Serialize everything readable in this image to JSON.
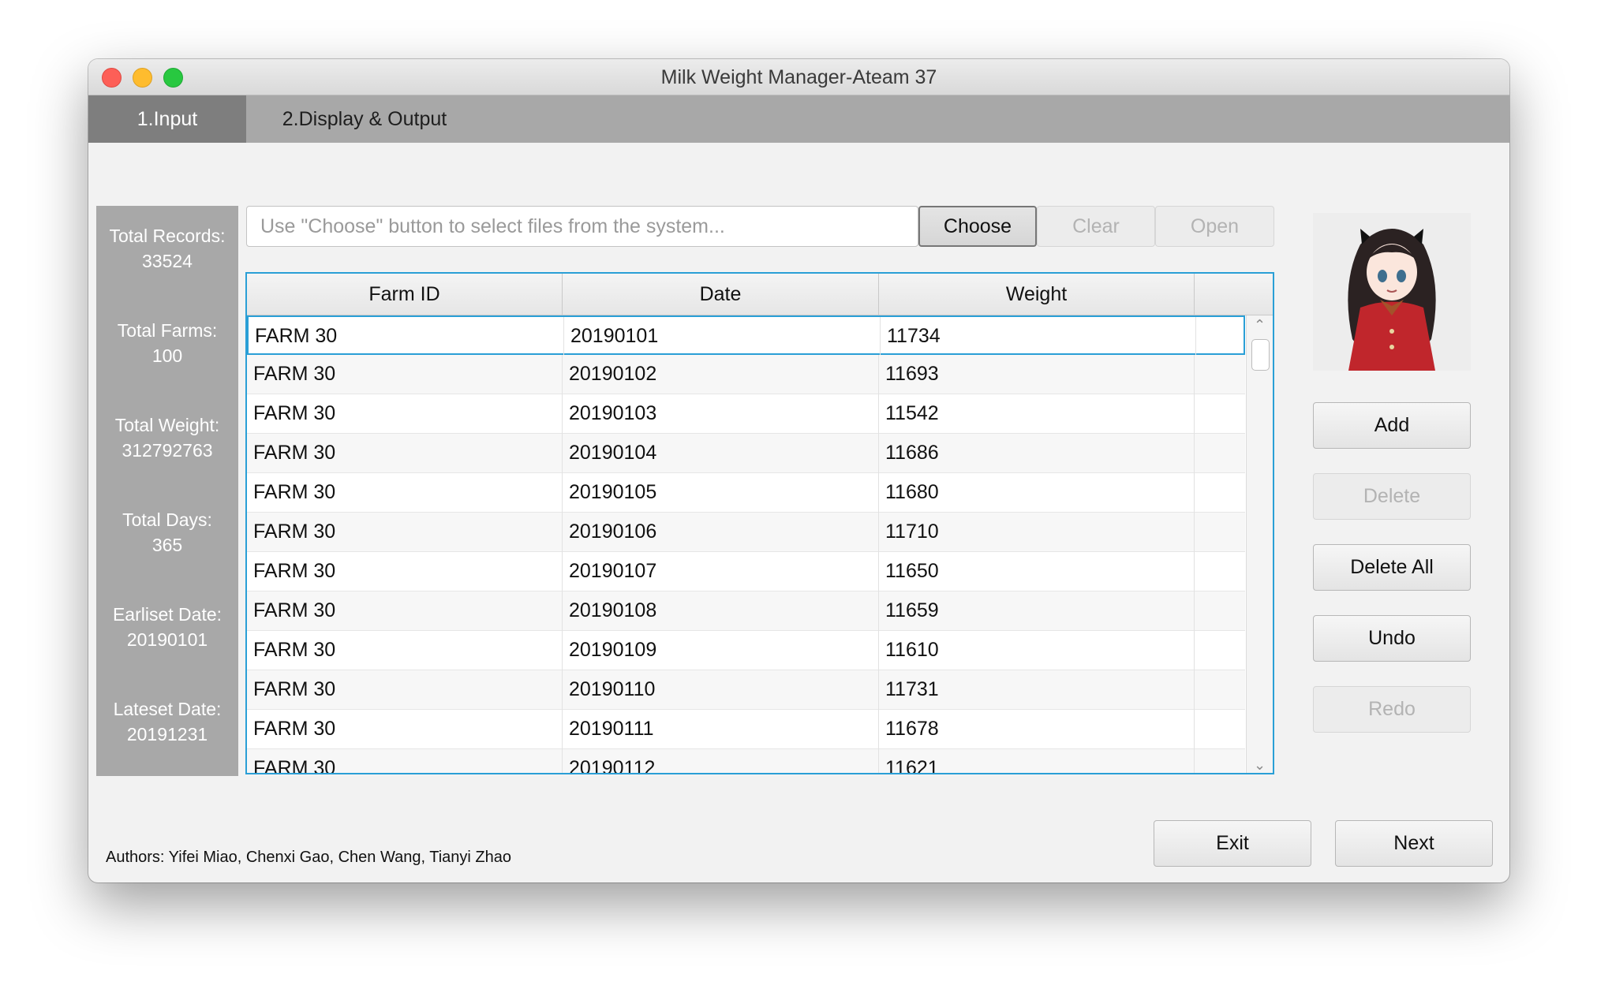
{
  "window": {
    "title": "Milk Weight Manager-Ateam 37"
  },
  "tabs": [
    {
      "label": "1.Input",
      "active": true
    },
    {
      "label": "2.Display & Output",
      "active": false
    }
  ],
  "stats": [
    {
      "label": "Total Records:",
      "value": "33524"
    },
    {
      "label": "Total Farms:",
      "value": "100"
    },
    {
      "label": "Total Weight:",
      "value": "312792763"
    },
    {
      "label": "Total Days:",
      "value": "365"
    },
    {
      "label": "Earliset Date:",
      "value": "20190101"
    },
    {
      "label": "Lateset Date:",
      "value": "20191231"
    }
  ],
  "file_input": {
    "placeholder": "Use \"Choose\" button to select files from the system..."
  },
  "file_buttons": {
    "choose": "Choose",
    "clear": "Clear",
    "open": "Open"
  },
  "table": {
    "columns": [
      "Farm ID",
      "Date",
      "Weight"
    ],
    "rows": [
      [
        "FARM 30",
        "20190101",
        "11734"
      ],
      [
        "FARM 30",
        "20190102",
        "11693"
      ],
      [
        "FARM 30",
        "20190103",
        "11542"
      ],
      [
        "FARM 30",
        "20190104",
        "11686"
      ],
      [
        "FARM 30",
        "20190105",
        "11680"
      ],
      [
        "FARM 30",
        "20190106",
        "11710"
      ],
      [
        "FARM 30",
        "20190107",
        "11650"
      ],
      [
        "FARM 30",
        "20190108",
        "11659"
      ],
      [
        "FARM 30",
        "20190109",
        "11610"
      ],
      [
        "FARM 30",
        "20190110",
        "11731"
      ],
      [
        "FARM 30",
        "20190111",
        "11678"
      ],
      [
        "FARM 30",
        "20190112",
        "11621"
      ]
    ]
  },
  "side_buttons": {
    "add": "Add",
    "delete": "Delete",
    "delete_all": "Delete All",
    "undo": "Undo",
    "redo": "Redo"
  },
  "footer": {
    "authors": "Authors: Yifei Miao, Chenxi Gao, Chen Wang, Tianyi Zhao",
    "exit": "Exit",
    "next": "Next"
  },
  "colors": {
    "accent": "#2a9fd6",
    "panel": "#a8a8a8",
    "active_tab": "#7e7e7e"
  }
}
